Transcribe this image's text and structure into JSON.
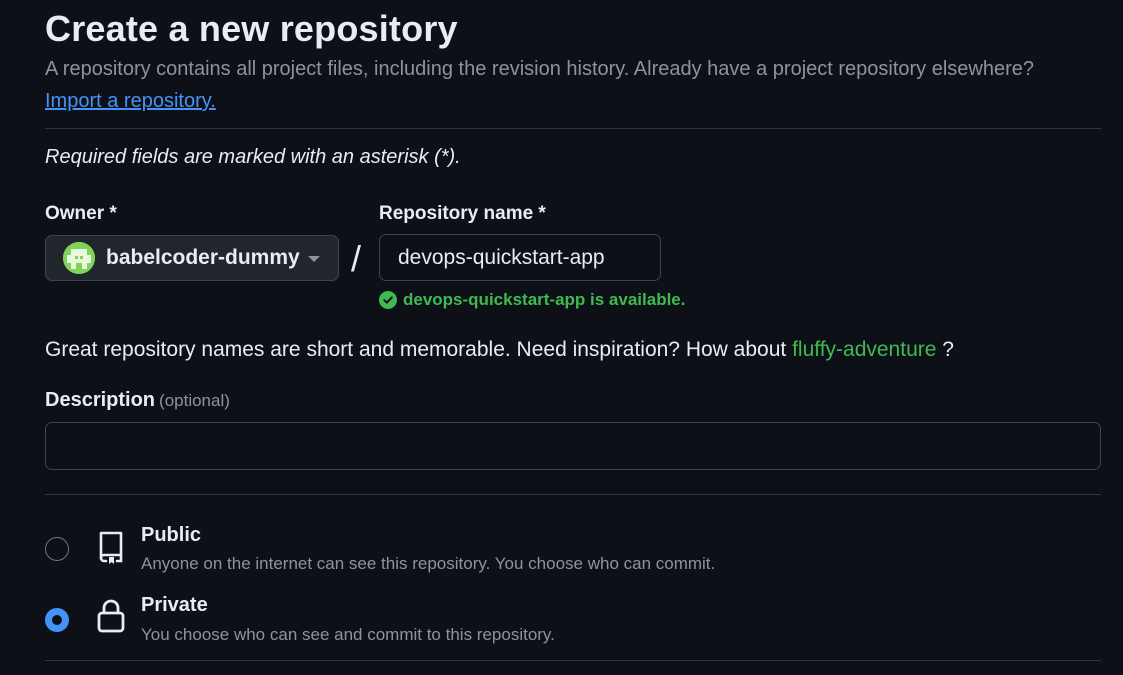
{
  "header": {
    "title": "Create a new repository",
    "subtitle": "A repository contains all project files, including the revision history. Already have a project repository elsewhere?",
    "import_link": "Import a repository."
  },
  "form": {
    "required_note": "Required fields are marked with an asterisk (*).",
    "owner": {
      "label": "Owner *",
      "value": "babelcoder-dummy"
    },
    "separator": "/",
    "repo_name": {
      "label": "Repository name *",
      "value": "devops-quickstart-app",
      "availability": "devops-quickstart-app is available."
    },
    "suggestion": {
      "text": "Great repository names are short and memorable. Need inspiration? How about",
      "name": "fluffy-adventure",
      "suffix": "?"
    },
    "description": {
      "label": "Description",
      "optional": "(optional)",
      "value": ""
    },
    "visibility": {
      "selected": "Private",
      "options": [
        {
          "title": "Public",
          "description": "Anyone on the internet can see this repository. You choose who can commit."
        },
        {
          "title": "Private",
          "description": "You choose who can see and commit to this repository."
        }
      ]
    }
  },
  "colors": {
    "background": "#0d1117",
    "link": "#4493f8",
    "success": "#3fb950",
    "muted": "#8b949e",
    "border": "#30363d"
  },
  "icons": {
    "owner_avatar": "avatar-icon",
    "owner_dropdown": "chevron-down-icon",
    "available": "check-circle-icon",
    "public": "repo-icon",
    "private": "lock-icon"
  }
}
